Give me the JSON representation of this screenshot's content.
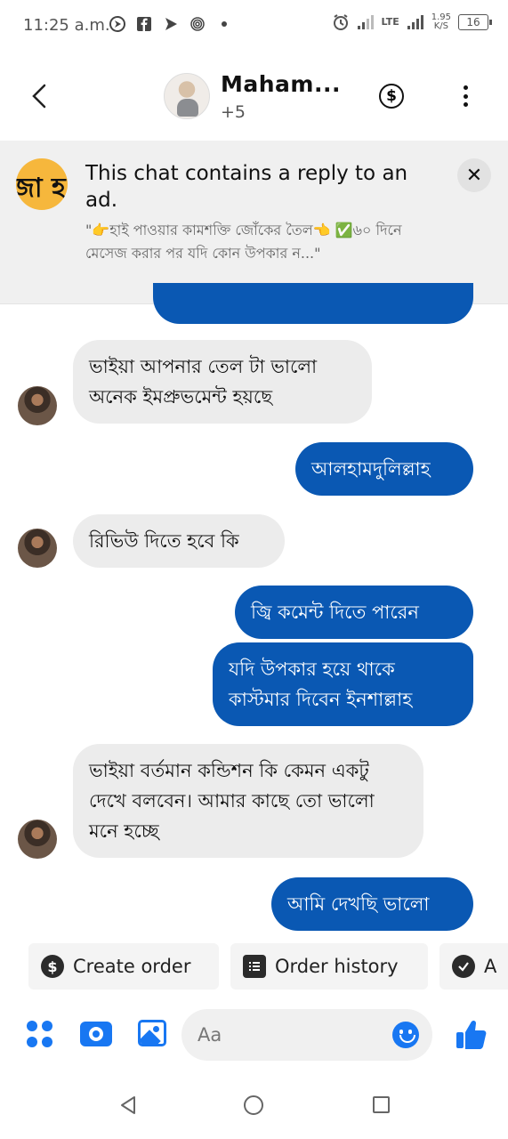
{
  "status_bar": {
    "time": "11:25 a.m.",
    "network": "LTE",
    "speed_value": "1.95",
    "speed_unit": "K/S",
    "battery": "16"
  },
  "header": {
    "name": "Maham...",
    "participants_extra": "+5"
  },
  "ad_banner": {
    "logo_text": "জা হ",
    "title": "This chat contains a reply to an ad.",
    "snippet": "\"👉হাই পাওয়ার কামশক্তি জোঁকের তৈল👈 ✅৬০ দিনে মেসেজ করার পর যদি কোন উপকার ন...\""
  },
  "messages": [
    {
      "direction": "in",
      "text": "ভাইয়া আপনার তেল টা ভালো অনেক ইমপ্রুভমেন্ট হয়ছে"
    },
    {
      "direction": "out",
      "text": "আলহামদুলিল্লাহ"
    },
    {
      "direction": "in",
      "text": "রিভিউ দিতে হবে কি"
    },
    {
      "direction": "out",
      "text": "জ্বি কমেন্ট দিতে পারেন"
    },
    {
      "direction": "out",
      "text": "যদি উপকার হয়ে থাকে কাস্টমার দিবেন ইনশাল্লাহ"
    },
    {
      "direction": "in",
      "text": "ভাইয়া বর্তমান কন্ডিশন কি কেমন একটু দেখে  বলবেন। আমার কাছে তো ভালো মনে হচ্ছে"
    },
    {
      "direction": "out",
      "text": "আমি দেখছি ভালো"
    }
  ],
  "quick_actions": {
    "create_order": "Create order",
    "order_history": "Order history",
    "third_partial": "A"
  },
  "composer": {
    "placeholder": "Aa"
  },
  "icons": {
    "accent": "#1877f2",
    "bubble_out": "#0a58b3",
    "bubble_in": "#ececec"
  }
}
